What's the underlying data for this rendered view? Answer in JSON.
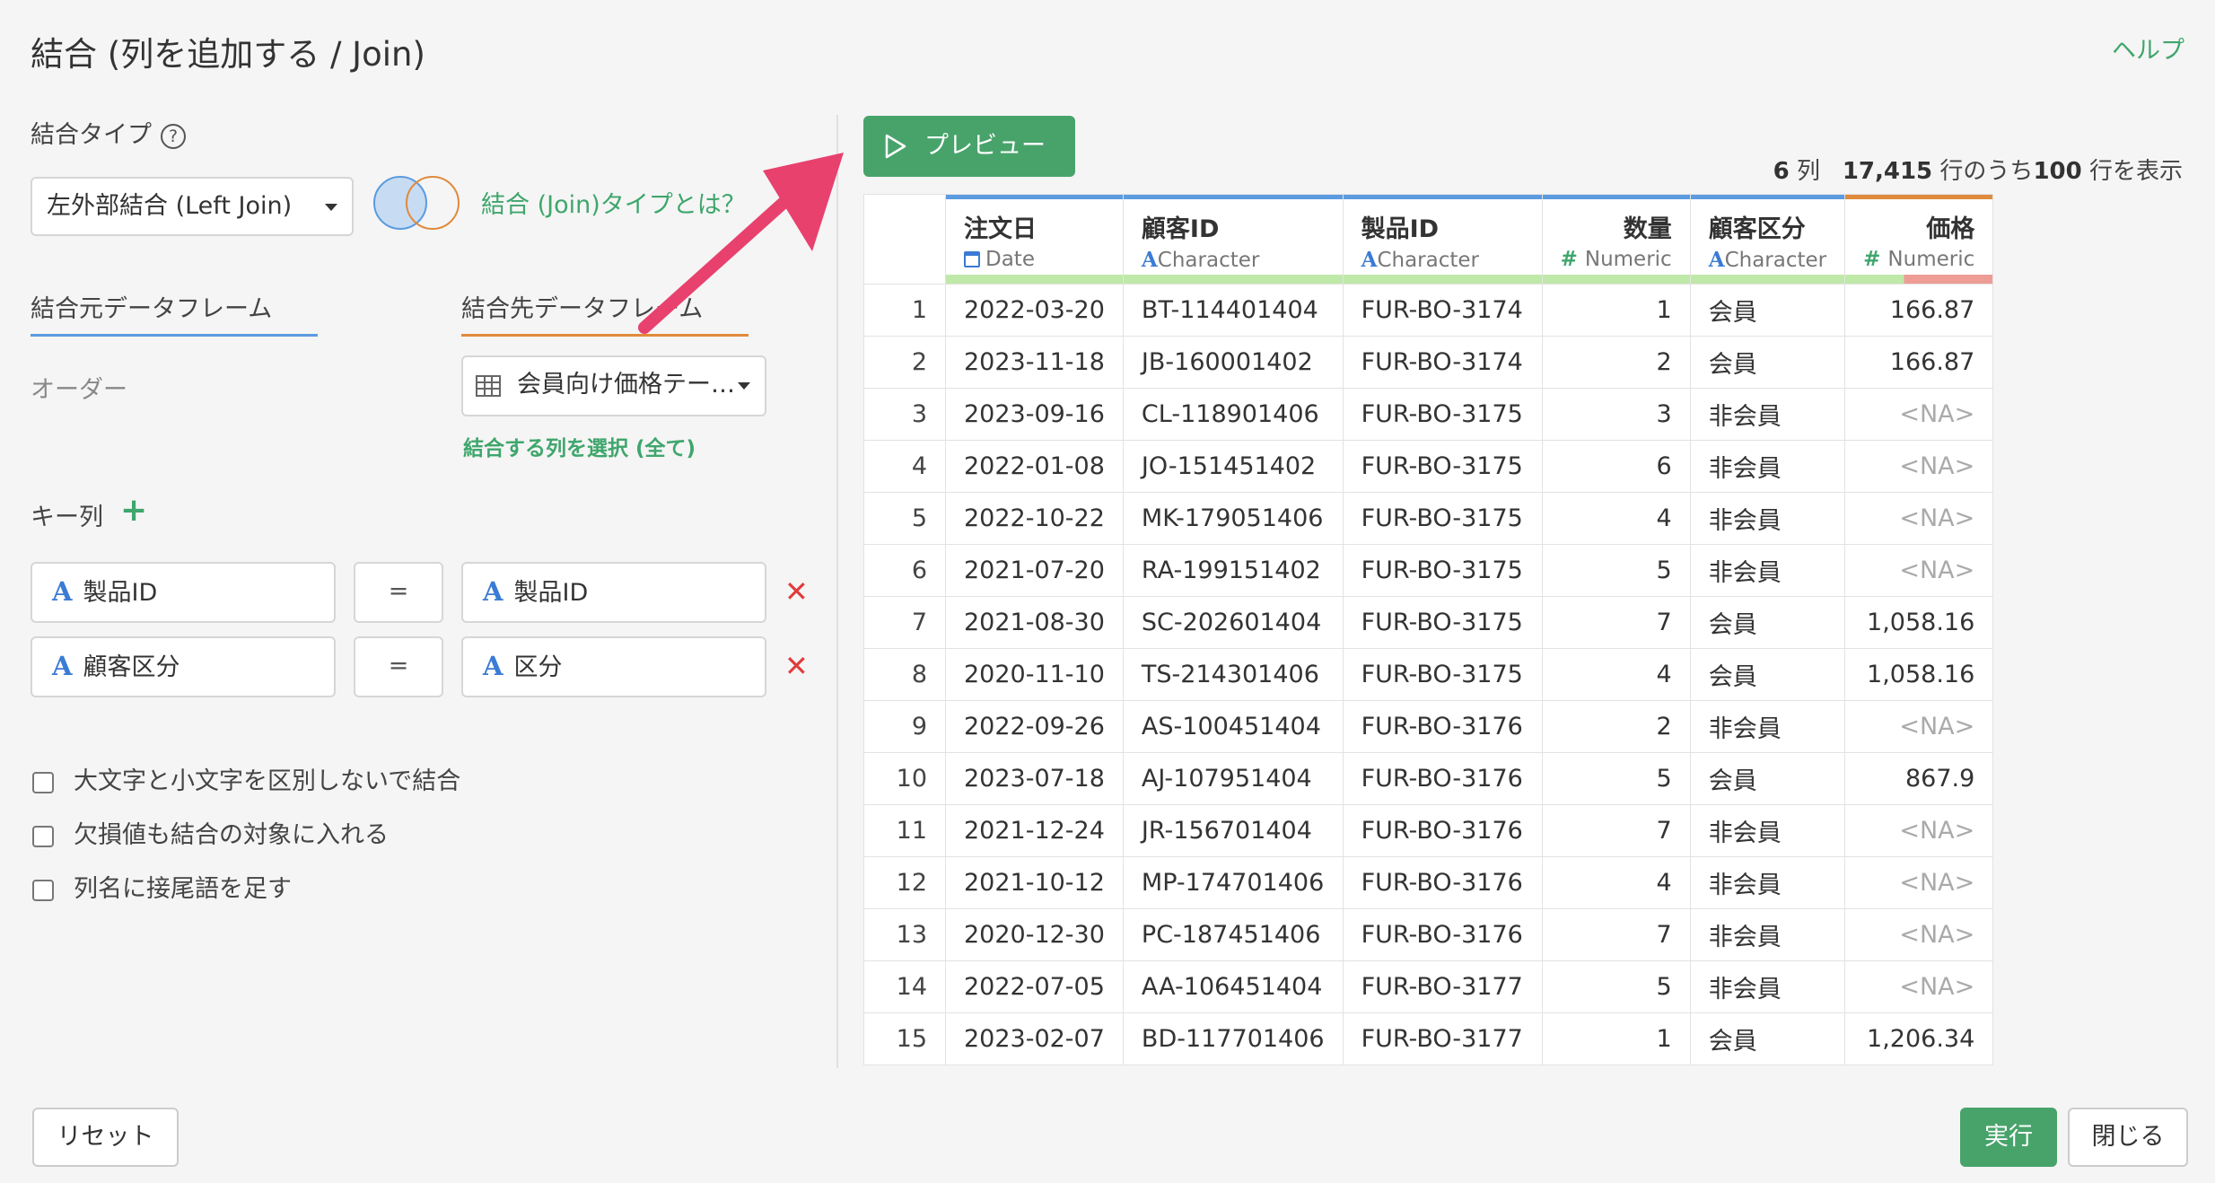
{
  "header": {
    "title": "結合 (列を追加する / Join)",
    "help": "ヘルプ"
  },
  "join_type": {
    "label": "結合タイプ",
    "help_icon": "question-circle-icon",
    "selected": "左外部結合 (Left Join)",
    "info_link": "結合 (Join)タイプとは？"
  },
  "tabs": {
    "source": "結合元データフレーム",
    "target": "結合先データフレーム",
    "source_color": "#5b9be0",
    "target_color": "#e08a3c"
  },
  "source": {
    "order_label": "オーダー"
  },
  "target": {
    "selected": "会員向け価格テー…",
    "select_columns_link": "結合する列を選択 (全て)"
  },
  "keys": {
    "label": "キー列",
    "rows": [
      {
        "left": "製品ID",
        "op": "=",
        "right": "製品ID"
      },
      {
        "left": "顧客区分",
        "op": "=",
        "right": "区分"
      }
    ]
  },
  "options": [
    "大文字と小文字を区別しないで結合",
    "欠損値も結合の対象に入れる",
    "列名に接尾語を足す"
  ],
  "preview": {
    "button": "プレビュー",
    "cols_count": "6",
    "cols_label": "列",
    "total_rows": "17,415",
    "of_label": "行のうち",
    "shown_rows": "100",
    "shown_label": "行を表示"
  },
  "table": {
    "columns": [
      {
        "name": "注文日",
        "type": "Date",
        "icon": "calendar-icon",
        "bar": "#5b9be0"
      },
      {
        "name": "顧客ID",
        "type": "Character",
        "icon": "A",
        "bar": "#5b9be0"
      },
      {
        "name": "製品ID",
        "type": "Character",
        "icon": "A",
        "bar": "#5b9be0"
      },
      {
        "name": "数量",
        "type": "Numeric",
        "icon": "#",
        "bar": "#5b9be0"
      },
      {
        "name": "顧客区分",
        "type": "Character",
        "icon": "A",
        "bar": "#5b9be0"
      },
      {
        "name": "価格",
        "type": "Numeric",
        "icon": "#",
        "bar": "#e08a3c"
      }
    ],
    "rows": [
      [
        "1",
        "2022-03-20",
        "BT-114401404",
        "FUR-BO-3174",
        "1",
        "会員",
        "166.87"
      ],
      [
        "2",
        "2023-11-18",
        "JB-160001402",
        "FUR-BO-3174",
        "2",
        "会員",
        "166.87"
      ],
      [
        "3",
        "2023-09-16",
        "CL-118901406",
        "FUR-BO-3175",
        "3",
        "非会員",
        "<NA>"
      ],
      [
        "4",
        "2022-01-08",
        "JO-151451402",
        "FUR-BO-3175",
        "6",
        "非会員",
        "<NA>"
      ],
      [
        "5",
        "2022-10-22",
        "MK-179051406",
        "FUR-BO-3175",
        "4",
        "非会員",
        "<NA>"
      ],
      [
        "6",
        "2021-07-20",
        "RA-199151402",
        "FUR-BO-3175",
        "5",
        "非会員",
        "<NA>"
      ],
      [
        "7",
        "2021-08-30",
        "SC-202601404",
        "FUR-BO-3175",
        "7",
        "会員",
        "1,058.16"
      ],
      [
        "8",
        "2020-11-10",
        "TS-214301406",
        "FUR-BO-3175",
        "4",
        "会員",
        "1,058.16"
      ],
      [
        "9",
        "2022-09-26",
        "AS-100451404",
        "FUR-BO-3176",
        "2",
        "非会員",
        "<NA>"
      ],
      [
        "10",
        "2023-07-18",
        "AJ-107951404",
        "FUR-BO-3176",
        "5",
        "会員",
        "867.9"
      ],
      [
        "11",
        "2021-12-24",
        "JR-156701404",
        "FUR-BO-3176",
        "7",
        "非会員",
        "<NA>"
      ],
      [
        "12",
        "2021-10-12",
        "MP-174701406",
        "FUR-BO-3176",
        "4",
        "非会員",
        "<NA>"
      ],
      [
        "13",
        "2020-12-30",
        "PC-187451406",
        "FUR-BO-3176",
        "7",
        "非会員",
        "<NA>"
      ],
      [
        "14",
        "2022-07-05",
        "AA-106451404",
        "FUR-BO-3177",
        "5",
        "非会員",
        "<NA>"
      ],
      [
        "15",
        "2023-02-07",
        "BD-117701406",
        "FUR-BO-3177",
        "1",
        "会員",
        "1,206.34"
      ]
    ]
  },
  "footer": {
    "reset": "リセット",
    "run": "実行",
    "close": "閉じる"
  },
  "colors": {
    "accent_green": "#48a36b",
    "link_green": "#3fa66c",
    "arrow": "#e8416e",
    "delete_red": "#e03b3b"
  }
}
